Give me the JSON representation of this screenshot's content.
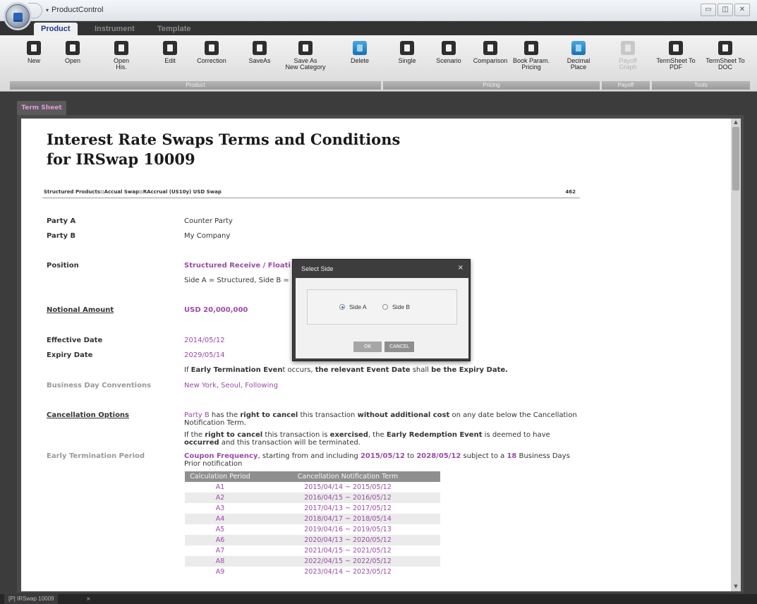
{
  "titlebar": {
    "title": "ProductControl",
    "qat_arrow": "▾",
    "min": "▭",
    "max": "◫",
    "close": "✕"
  },
  "tabs": [
    "Product",
    "Instrument",
    "Template"
  ],
  "ribbon": {
    "buttons": [
      {
        "label": "New",
        "icon": "document-icon"
      },
      {
        "label": "Open",
        "icon": "folder-icon"
      },
      {
        "label": "Open\nHis.",
        "icon": "open-history-icon"
      },
      {
        "label": "Edit",
        "icon": "edit-icon"
      },
      {
        "label": "Correction",
        "icon": "correction-icon"
      },
      {
        "label": "SaveAs",
        "icon": "save-icon"
      },
      {
        "label": "Save As\nNew Category",
        "icon": "save-category-icon"
      },
      {
        "label": "Delete",
        "icon": "delete-icon"
      },
      {
        "label": "Single",
        "icon": "calculator-icon"
      },
      {
        "label": "Scenario",
        "icon": "monitor-icon"
      },
      {
        "label": "Comparison",
        "icon": "comparison-icon"
      },
      {
        "label": "Book Param.\nPricing",
        "icon": "book-param-icon"
      },
      {
        "label": "Decimal\nPlace",
        "icon": "refresh-icon"
      },
      {
        "label": "Payoff\nGraph",
        "icon": "chart-icon"
      },
      {
        "label": "TermSheet To\nPDF",
        "icon": "pdf-icon"
      },
      {
        "label": "TermSheet To\nDOC",
        "icon": "doc-icon"
      }
    ],
    "groups": [
      "Product",
      "Pricing",
      "Payoff",
      "Tools"
    ]
  },
  "doc_tab": "Term Sheet",
  "document": {
    "title_line1": "Interest Rate Swaps Terms and Conditions",
    "title_line2": "for IRSwap 10009",
    "path": "Structured Products::Accual Swap::RAccrual (US10y) USD Swap",
    "number": "462",
    "party_a_label": "Party A",
    "party_a_value": "Counter Party",
    "party_b_label": "Party B",
    "party_b_value": "My Company",
    "position_label": "Position",
    "position_value": "Structured Receive / Floati",
    "position_note": "Side A = Structured, Side B =",
    "notional_label": "Notional Amount",
    "notional_value": "USD 20,000,000",
    "effective_label": "Effective Date",
    "effective_value": "2014/05/12",
    "expiry_label": "Expiry Date",
    "expiry_value": "2029/05/14",
    "early_term_prefix": "If ",
    "early_term_event": "Early Termination Even",
    "early_term_t": "t occurs, ",
    "early_term_mid": "the relevant Event Date",
    "early_term_shall": " shall ",
    "early_term_end": "be the Expiry Date.",
    "bdc_label": "Business Day Conventions",
    "bdc_value": "New York, Seoul, Following",
    "cancel_label": "Cancellation Options",
    "cancel_p1_a": "Party B",
    "cancel_p1_b": " has the ",
    "cancel_p1_c": "right to cancel",
    "cancel_p1_d": " this transaction ",
    "cancel_p1_e": "without additional cost",
    "cancel_p1_f": " on any date below the Cancellation Notification Term.",
    "cancel_p2_a": "If the ",
    "cancel_p2_b": "right to cancel",
    "cancel_p2_c": " this transaction is ",
    "cancel_p2_d": "exercised",
    "cancel_p2_e": ", the ",
    "cancel_p2_f": "Early Redemption Event",
    "cancel_p2_g": " is deemed to have ",
    "cancel_p2_h": "occurred",
    "cancel_p2_i": " and this transaction will be terminated.",
    "etp_label": "Early Termination Period",
    "etp_a": "Coupon Frequency",
    "etp_b": ", starting from and including ",
    "etp_c": "2015/05/12",
    "etp_d": " to ",
    "etp_e": "2028/05/12",
    "etp_f": " subject to a ",
    "etp_g": "18",
    "etp_h": " Business Days Prior notification"
  },
  "schedule": {
    "headers": [
      "Calculation Period",
      "Cancellation Notification Term"
    ],
    "rows": [
      [
        "A1",
        "2015/04/14 ~ 2015/05/12"
      ],
      [
        "A2",
        "2016/04/15 ~ 2016/05/12"
      ],
      [
        "A3",
        "2017/04/13 ~ 2017/05/12"
      ],
      [
        "A4",
        "2018/04/17 ~ 2018/05/14"
      ],
      [
        "A5",
        "2019/04/16 ~ 2019/05/13"
      ],
      [
        "A6",
        "2020/04/13 ~ 2020/05/12"
      ],
      [
        "A7",
        "2021/04/15 ~ 2021/05/12"
      ],
      [
        "A8",
        "2022/04/15 ~ 2022/05/12"
      ],
      [
        "A9",
        "2023/04/14 ~ 2023/05/12"
      ]
    ]
  },
  "dialog": {
    "title": "Select Side",
    "close": "×",
    "option_a": "Side A",
    "option_b": "Side B",
    "selected": "Side A",
    "ok": "OK",
    "cancel": "CANCEL"
  },
  "bottom_tab": {
    "label": "[P] IRSwap 10009",
    "close": "×"
  },
  "colors": {
    "accent_purple": "#9b4ba6",
    "tab_active_text": "#1b3c87",
    "dialog_bg": "#3d3d3d"
  }
}
